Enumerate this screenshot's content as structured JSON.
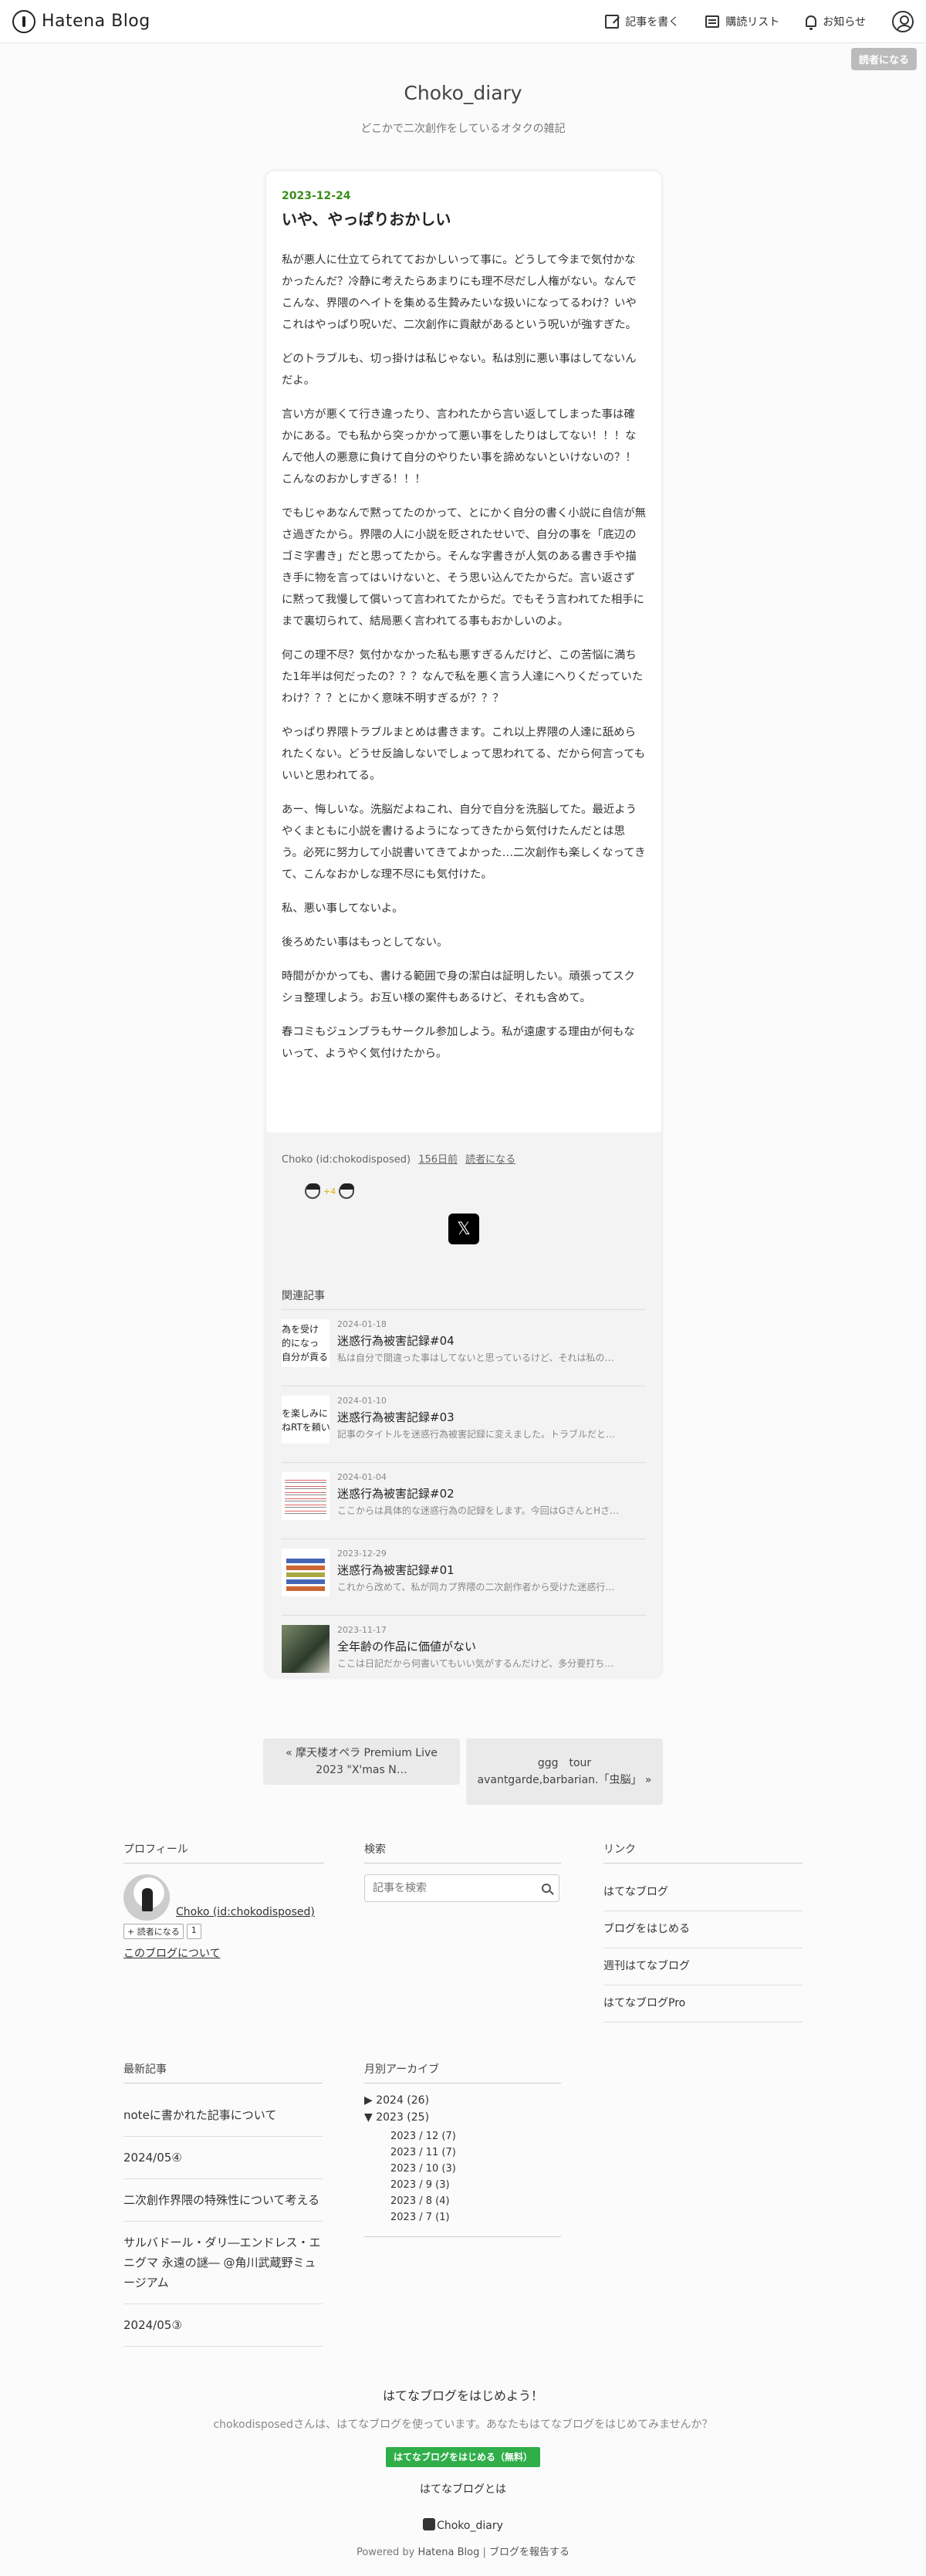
{
  "header": {
    "logo_text": "Hatena Blog",
    "write_label": "記事を書く",
    "reader_list_label": "購読リスト",
    "notice_label": "お知らせ",
    "subscribe_label": "読者になる"
  },
  "blog": {
    "title": "Choko_diary",
    "description": "どこかで二次創作をしているオタクの雑記"
  },
  "article": {
    "date": "2023-12-24",
    "title": "いや、やっぱりおかしい",
    "paragraphs": [
      "私が悪人に仕立てられてておかしいって事に。どうして今まで気付かなかったんだ？冷静に考えたらあまりにも理不尽だし人権がない。なんでこんな、界隈のヘイトを集める生贄みたいな扱いになってるわけ？いやこれはやっぱり呪いだ、二次創作に貢献があるという呪いが強すぎた。",
      "どのトラブルも、切っ掛けは私じゃない。私は別に悪い事はしてないんだよ。",
      "言い方が悪くて行き違ったり、言われたから言い返してしまった事は確かにある。でも私から突っかかって悪い事をしたりはしてない！！！なんで他人の悪意に負けて自分のやりたい事を諦めないといけないの？！こんなのおかしすぎる！！！",
      "でもじゃあなんで黙ってたのかって、とにかく自分の書く小説に自信が無さ過ぎたから。界隈の人に小説を貶されたせいで、自分の事を「底辺のゴミ字書き」だと思ってたから。そんな字書きが人気のある書き手や描き手に物を言ってはいけないと、そう思い込んでたからだ。言い返さずに黙って我慢して償いって言われてたからだ。でもそう言われてた相手にまで裏切られて、結局悪く言われてる事もおかしいのよ。",
      "何この理不尽？気付かなかった私も悪すぎるんだけど、この苦悩に満ちた1年半は何だったの？？？なんで私を悪く言う人達にへりくだっていたわけ？？？とにかく意味不明すぎるが？？？",
      "やっぱり界隈トラブルまとめは書きます。これ以上界隈の人達に舐められたくない。どうせ反論しないでしょって思われてる、だから何言ってもいいと思われてる。",
      "あー、悔しいな。洗脳だよねこれ、自分で自分を洗脳してた。最近ようやくまともに小説を書けるようになってきたから気付けたんだとは思う。必死に努力して小説書いてきてよかった…二次創作も楽しくなってきて、こんなおかしな理不尽にも気付けた。",
      "私、悪い事してないよ。",
      "後ろめたい事はもっとしてない。",
      "時間がかかっても、書ける範囲で身の潔白は証明したい。頑張ってスクショ整理しよう。お互い様の案件もあるけど、それも含めて。",
      "春コミもジュンブラもサークル参加しよう。私が遠慮する理由が何もないって、ようやく気付けたから。"
    ],
    "author": "Choko (id:chokodisposed)",
    "days_ago": "156日前",
    "subscribe_link": "読者になる",
    "star_count": "+4",
    "x_share": "𝕏",
    "related_title": "関連記事",
    "related": [
      {
        "date": "2024-01-18",
        "title": "迷惑行為被害記録#04",
        "snippet": "私は自分で間違った事はしてないと思っているけど、それは私の…",
        "thumb_text": "為を受け\n的になっ\n自分が貢る"
      },
      {
        "date": "2024-01-10",
        "title": "迷惑行為被害記録#03",
        "snippet": "記事のタイトルを迷惑行為被害記録に変えました。トラブルだと…",
        "thumb_text": "を楽しみに\nねRTを頼い"
      },
      {
        "date": "2024-01-04",
        "title": "迷惑行為被害記録#02",
        "snippet": "ここからは具体的な迷惑行為の記録をします。今回はGさんとHさ…",
        "thumb_text": ""
      },
      {
        "date": "2023-12-29",
        "title": "迷惑行為被害記録#01",
        "snippet": "これから改めて、私が同カプ界隈の二次創作者から受けた迷惑行…",
        "thumb_text": ""
      },
      {
        "date": "2023-11-17",
        "title": "全年齢の作品に価値がない",
        "snippet": "ここは日記だから何書いてもいい気がするんだけど、多分要打ち…",
        "thumb_text": ""
      }
    ]
  },
  "pager": {
    "prev": "« 摩天楼オペラ Premium Live 2023 \"X'mas N…",
    "next": "ggg　tour avantgarde,barbarian.「虫脳」 »"
  },
  "sidebar": {
    "profile_title": "プロフィール",
    "profile_name": "Choko (id:chokodisposed)",
    "reader_button": "読者になる",
    "reader_count": "1",
    "about_link": "このブログについて",
    "search_title": "検索",
    "search_placeholder": "記事を検索",
    "links_title": "リンク",
    "links": [
      "はてなブログ",
      "ブログをはじめる",
      "週刊はてなブログ",
      "はてなブログPro"
    ],
    "recent_title": "最新記事",
    "recent": [
      "noteに書かれた記事について",
      "2024/05④",
      "二次創作界隈の特殊性について考える",
      "サルバドール・ダリ―エンドレス・エニグマ 永遠の謎― @角川武蔵野ミュージアム",
      "2024/05③"
    ],
    "archive_title": "月別アーカイブ",
    "archive_2024": "2024 (26)",
    "archive_2023": "2023 (25)",
    "archive_months": [
      "2023 / 12 (7)",
      "2023 / 11 (7)",
      "2023 / 10 (3)",
      "2023 / 9 (3)",
      "2023 / 8 (4)",
      "2023 / 7 (1)"
    ]
  },
  "footer": {
    "start_title": "はてなブログをはじめよう！",
    "message": "chokodisposedさんは、はてなブログを使っています。あなたもはてなブログをはじめてみませんか？",
    "start_button": "はてなブログをはじめる（無料）",
    "about": "はてなブログとは",
    "blog_name": "Choko_diary",
    "powered_prefix": "Powered by ",
    "powered_link": "Hatena Blog",
    "report_sep": " | ",
    "report_link": "ブログを報告する"
  },
  "colors": {
    "date": "#3b8e1a",
    "start_button": "#2fae4a"
  }
}
